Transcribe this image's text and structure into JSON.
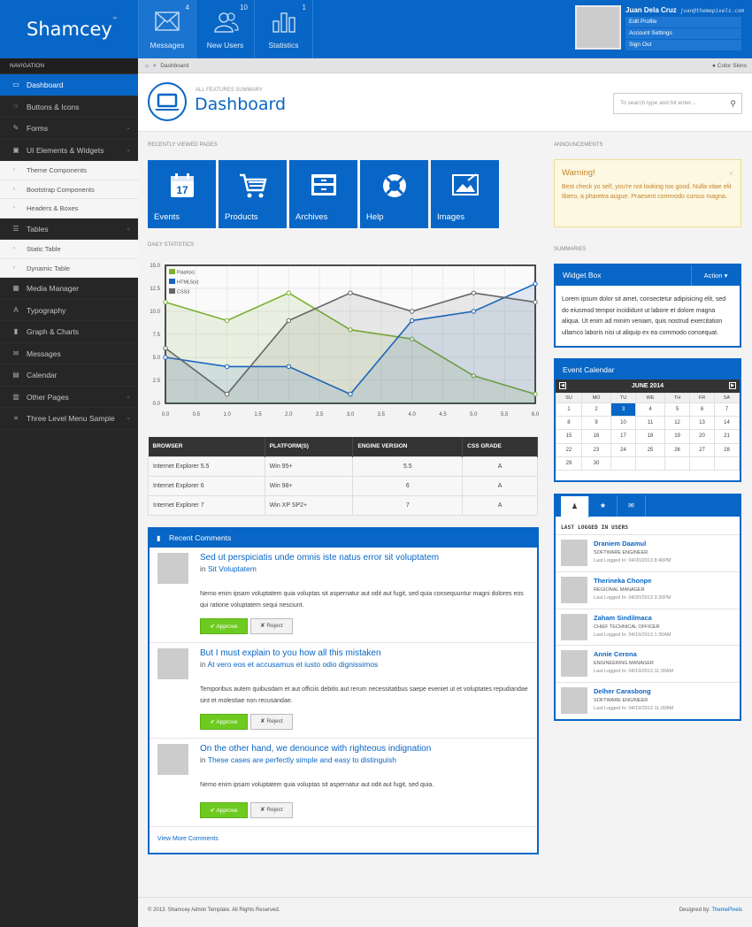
{
  "brand": {
    "name": "Shamcey",
    "tm": "™"
  },
  "header_nav": [
    {
      "label": "Messages",
      "count": "4",
      "icon": "envelope-icon"
    },
    {
      "label": "New Users",
      "count": "10",
      "icon": "users-icon"
    },
    {
      "label": "Statistics",
      "count": "1",
      "icon": "bar-chart-icon"
    }
  ],
  "user": {
    "name": "Juan Dela Cruz",
    "email": "juan@themepixels.com",
    "menu": [
      "Edit Profile",
      "Account Settings",
      "Sign Out"
    ]
  },
  "sidebar": {
    "heading": "NAVIGATION",
    "items": [
      {
        "label": "Dashboard",
        "icon": "laptop-icon",
        "active": true
      },
      {
        "label": "Buttons & Icons",
        "icon": "hand-icon"
      },
      {
        "label": "Forms",
        "icon": "pencil-icon",
        "expandable": true
      },
      {
        "label": "UI Elements & Widgets",
        "icon": "briefcase-icon",
        "expandable": true
      },
      {
        "label": "Theme Components",
        "sub": true
      },
      {
        "label": "Bootstrap Components",
        "sub": true
      },
      {
        "label": "Headers & Boxes",
        "sub": true
      },
      {
        "label": "Tables",
        "icon": "table-icon",
        "expandable": true
      },
      {
        "label": "Static Table",
        "sub": true
      },
      {
        "label": "Dynamic Table",
        "sub": true
      },
      {
        "label": "Media Manager",
        "icon": "picture-icon"
      },
      {
        "label": "Typography",
        "icon": "font-icon"
      },
      {
        "label": "Graph & Charts",
        "icon": "signal-icon"
      },
      {
        "label": "Messages",
        "icon": "envelope-icon"
      },
      {
        "label": "Calendar",
        "icon": "calendar-icon"
      },
      {
        "label": "Other Pages",
        "icon": "book-icon",
        "expandable": true
      },
      {
        "label": "Three Level Menu Sample",
        "icon": "th-list-icon",
        "expandable": true
      }
    ]
  },
  "breadcrumb": {
    "home_icon": "home-icon",
    "sep": ">",
    "current": "Dashboard",
    "skins": "Color Skins"
  },
  "page": {
    "subtitle": "ALL FEATURES SUMMARY",
    "title": "Dashboard"
  },
  "search": {
    "placeholder": "To search type and hit enter..."
  },
  "sections": {
    "recent": "RECENTLY VIEWED PAGES",
    "daily": "DAILY STATISTICS",
    "announcements": "ANNOUNCEMENTS",
    "summaries": "SUMMARIES"
  },
  "tiles": [
    {
      "label": "Events",
      "icon": "calendar-icon",
      "day": "17"
    },
    {
      "label": "Products",
      "icon": "cart-icon"
    },
    {
      "label": "Archives",
      "icon": "archive-icon"
    },
    {
      "label": "Help",
      "icon": "lifebuoy-icon"
    },
    {
      "label": "Images",
      "icon": "image-icon"
    }
  ],
  "chart_data": {
    "type": "area",
    "x": [
      0,
      1,
      2,
      3,
      4,
      5,
      6
    ],
    "x_ticks": [
      "0.0",
      "0.5",
      "1.0",
      "1.5",
      "2.0",
      "2.5",
      "3.0",
      "3.5",
      "4.0",
      "4.5",
      "5.0",
      "5.5",
      "6.0"
    ],
    "y_ticks": [
      "0.0",
      "2.5",
      "5.0",
      "7.5",
      "10.0",
      "12.5",
      "15.0"
    ],
    "ylim": [
      0,
      15
    ],
    "xlim": [
      0,
      6
    ],
    "grid": true,
    "legend": "top-left",
    "series": [
      {
        "name": "Flash(x)",
        "color": "#7cb031",
        "values": [
          11,
          9,
          12,
          8,
          7,
          3,
          1
        ]
      },
      {
        "name": "HTML5(x)",
        "color": "#1565c0",
        "values": [
          5,
          4,
          4,
          1,
          9,
          10,
          13
        ]
      },
      {
        "name": "CSS3",
        "color": "#666666",
        "values": [
          6,
          1,
          9,
          12,
          10,
          12,
          11
        ]
      }
    ]
  },
  "browser_table": {
    "headers": [
      "BROWSER",
      "PLATFORM(S)",
      "ENGINE VERSION",
      "CSS GRADE"
    ],
    "rows": [
      [
        "Internet Explorer 5.5",
        "Win 95+",
        "5.5",
        "A"
      ],
      [
        "Internet Explorer 6",
        "Win 98+",
        "6",
        "A"
      ],
      [
        "Internet Explorer 7",
        "Win XP SP2+",
        "7",
        "A"
      ]
    ]
  },
  "comments": {
    "title": "Recent Comments",
    "items": [
      {
        "title": "Sed ut perspiciatis unde omnis iste natus error sit voluptatem",
        "in": "in",
        "link": "Sit Voluptatem",
        "body": "Nemo enim ipsam voluptatem quia voluptas sit aspernatur aut odit aut fugit, sed quia consequuntur magni dolores eos qui ratione voluptatem sequi nesciunt."
      },
      {
        "title": "But I must explain to you how all this mistaken",
        "in": "in",
        "link": "At vero eos et accusamus et iusto odio dignissimos",
        "body": "Temporibus autem quibusdam et aut officiis debitis aut rerum necessitatibus saepe eveniet ut et voluptates repudiandae sint et molestiae non recusandae."
      },
      {
        "title": "On the other hand, we denounce with righteous indignation",
        "in": "in",
        "link": "These cases are perfectly simple and easy to distinguish",
        "body": "Nemo enim ipsam voluptatem quia voluptas sit aspernatur aut odit aut fugit, sed quia."
      }
    ],
    "approve": "Approve",
    "reject": "Reject",
    "view_more": "View More Comments"
  },
  "warning": {
    "title": "Warning!",
    "text": "Best check yo self, you're not looking too good. Nulla vitae elit libero, a pharetra augue. Praesent commodo cursus magna.",
    "close": "×"
  },
  "widget": {
    "title": "Widget Box",
    "action": "Action",
    "text": "Lorem ipsum dolor sit amet, consectetur adipisicing elit, sed do eiusmod tempor incididunt ut labore et dolore magna aliqua. Ut enim ad minim veniam, quis nostrud exercitation ullamco laboris nisi ut aliquip ex ea commodo consequat."
  },
  "calendar": {
    "title": "Event Calendar",
    "month": "JUNE 2014",
    "days": [
      "SU",
      "MO",
      "TU",
      "WE",
      "TH",
      "FR",
      "SA"
    ],
    "selected": 3,
    "weeks": [
      [
        "1",
        "2",
        "3",
        "4",
        "5",
        "6",
        "7"
      ],
      [
        "8",
        "9",
        "10",
        "11",
        "12",
        "13",
        "14"
      ],
      [
        "15",
        "16",
        "17",
        "18",
        "19",
        "20",
        "21"
      ],
      [
        "22",
        "23",
        "24",
        "25",
        "26",
        "27",
        "28"
      ],
      [
        "29",
        "30",
        "",
        "",
        "",
        "",
        ""
      ]
    ]
  },
  "users_panel": {
    "tabs": [
      "user-icon",
      "star-icon",
      "comments-icon"
    ],
    "heading": "LAST LOGGED IN USERS",
    "users": [
      {
        "name": "Draniem Daamul",
        "role": "SOFTWARE ENGINEER",
        "last": "Last Logged In: 04/20/2013 8:40PM"
      },
      {
        "name": "Therineka Chonpe",
        "role": "REGIONAL MANAGER",
        "last": "Last Logged In: 04/20/2013 3:30PM"
      },
      {
        "name": "Zaham Sindilmaca",
        "role": "CHIEF TECHNICAL OFFICER",
        "last": "Last Logged In: 04/19/2013 1:30AM"
      },
      {
        "name": "Annie Cerona",
        "role": "ENGINEERING MANAGER",
        "last": "Last Logged In: 04/19/2013 11:30AM"
      },
      {
        "name": "Delher Carasbong",
        "role": "SOFTWARE ENGINEER",
        "last": "Last Logged In: 04/19/2013 11:00AM"
      }
    ]
  },
  "footer": {
    "copy": "© 2013. Shamcey Admin Template. All Rights Reserved.",
    "designed": "Designed by:",
    "author": "ThemePixels"
  }
}
